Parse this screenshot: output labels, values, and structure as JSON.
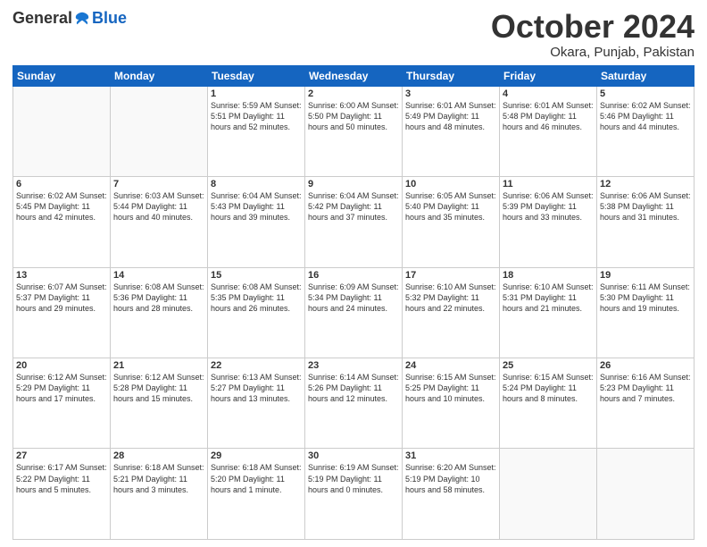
{
  "header": {
    "logo_general": "General",
    "logo_blue": "Blue",
    "month_title": "October 2024",
    "location": "Okara, Punjab, Pakistan"
  },
  "days_of_week": [
    "Sunday",
    "Monday",
    "Tuesday",
    "Wednesday",
    "Thursday",
    "Friday",
    "Saturday"
  ],
  "weeks": [
    [
      {
        "day": "",
        "info": ""
      },
      {
        "day": "",
        "info": ""
      },
      {
        "day": "1",
        "info": "Sunrise: 5:59 AM\nSunset: 5:51 PM\nDaylight: 11 hours and 52 minutes."
      },
      {
        "day": "2",
        "info": "Sunrise: 6:00 AM\nSunset: 5:50 PM\nDaylight: 11 hours and 50 minutes."
      },
      {
        "day": "3",
        "info": "Sunrise: 6:01 AM\nSunset: 5:49 PM\nDaylight: 11 hours and 48 minutes."
      },
      {
        "day": "4",
        "info": "Sunrise: 6:01 AM\nSunset: 5:48 PM\nDaylight: 11 hours and 46 minutes."
      },
      {
        "day": "5",
        "info": "Sunrise: 6:02 AM\nSunset: 5:46 PM\nDaylight: 11 hours and 44 minutes."
      }
    ],
    [
      {
        "day": "6",
        "info": "Sunrise: 6:02 AM\nSunset: 5:45 PM\nDaylight: 11 hours and 42 minutes."
      },
      {
        "day": "7",
        "info": "Sunrise: 6:03 AM\nSunset: 5:44 PM\nDaylight: 11 hours and 40 minutes."
      },
      {
        "day": "8",
        "info": "Sunrise: 6:04 AM\nSunset: 5:43 PM\nDaylight: 11 hours and 39 minutes."
      },
      {
        "day": "9",
        "info": "Sunrise: 6:04 AM\nSunset: 5:42 PM\nDaylight: 11 hours and 37 minutes."
      },
      {
        "day": "10",
        "info": "Sunrise: 6:05 AM\nSunset: 5:40 PM\nDaylight: 11 hours and 35 minutes."
      },
      {
        "day": "11",
        "info": "Sunrise: 6:06 AM\nSunset: 5:39 PM\nDaylight: 11 hours and 33 minutes."
      },
      {
        "day": "12",
        "info": "Sunrise: 6:06 AM\nSunset: 5:38 PM\nDaylight: 11 hours and 31 minutes."
      }
    ],
    [
      {
        "day": "13",
        "info": "Sunrise: 6:07 AM\nSunset: 5:37 PM\nDaylight: 11 hours and 29 minutes."
      },
      {
        "day": "14",
        "info": "Sunrise: 6:08 AM\nSunset: 5:36 PM\nDaylight: 11 hours and 28 minutes."
      },
      {
        "day": "15",
        "info": "Sunrise: 6:08 AM\nSunset: 5:35 PM\nDaylight: 11 hours and 26 minutes."
      },
      {
        "day": "16",
        "info": "Sunrise: 6:09 AM\nSunset: 5:34 PM\nDaylight: 11 hours and 24 minutes."
      },
      {
        "day": "17",
        "info": "Sunrise: 6:10 AM\nSunset: 5:32 PM\nDaylight: 11 hours and 22 minutes."
      },
      {
        "day": "18",
        "info": "Sunrise: 6:10 AM\nSunset: 5:31 PM\nDaylight: 11 hours and 21 minutes."
      },
      {
        "day": "19",
        "info": "Sunrise: 6:11 AM\nSunset: 5:30 PM\nDaylight: 11 hours and 19 minutes."
      }
    ],
    [
      {
        "day": "20",
        "info": "Sunrise: 6:12 AM\nSunset: 5:29 PM\nDaylight: 11 hours and 17 minutes."
      },
      {
        "day": "21",
        "info": "Sunrise: 6:12 AM\nSunset: 5:28 PM\nDaylight: 11 hours and 15 minutes."
      },
      {
        "day": "22",
        "info": "Sunrise: 6:13 AM\nSunset: 5:27 PM\nDaylight: 11 hours and 13 minutes."
      },
      {
        "day": "23",
        "info": "Sunrise: 6:14 AM\nSunset: 5:26 PM\nDaylight: 11 hours and 12 minutes."
      },
      {
        "day": "24",
        "info": "Sunrise: 6:15 AM\nSunset: 5:25 PM\nDaylight: 11 hours and 10 minutes."
      },
      {
        "day": "25",
        "info": "Sunrise: 6:15 AM\nSunset: 5:24 PM\nDaylight: 11 hours and 8 minutes."
      },
      {
        "day": "26",
        "info": "Sunrise: 6:16 AM\nSunset: 5:23 PM\nDaylight: 11 hours and 7 minutes."
      }
    ],
    [
      {
        "day": "27",
        "info": "Sunrise: 6:17 AM\nSunset: 5:22 PM\nDaylight: 11 hours and 5 minutes."
      },
      {
        "day": "28",
        "info": "Sunrise: 6:18 AM\nSunset: 5:21 PM\nDaylight: 11 hours and 3 minutes."
      },
      {
        "day": "29",
        "info": "Sunrise: 6:18 AM\nSunset: 5:20 PM\nDaylight: 11 hours and 1 minute."
      },
      {
        "day": "30",
        "info": "Sunrise: 6:19 AM\nSunset: 5:19 PM\nDaylight: 11 hours and 0 minutes."
      },
      {
        "day": "31",
        "info": "Sunrise: 6:20 AM\nSunset: 5:19 PM\nDaylight: 10 hours and 58 minutes."
      },
      {
        "day": "",
        "info": ""
      },
      {
        "day": "",
        "info": ""
      }
    ]
  ]
}
